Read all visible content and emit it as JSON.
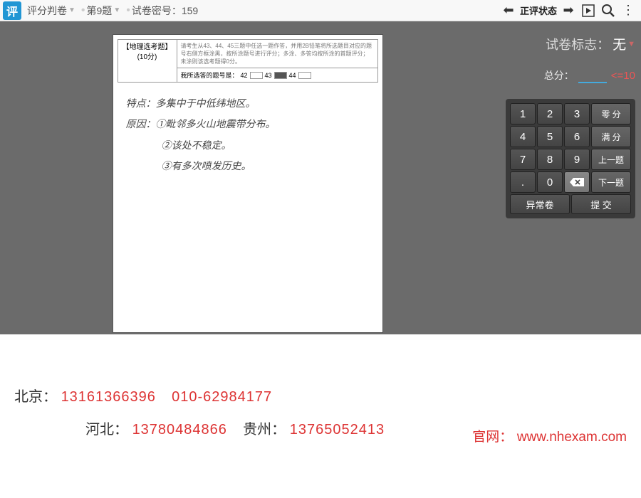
{
  "toolbar": {
    "logo": "评",
    "app_name": "评分判卷",
    "question": "第9题",
    "secret_label": "试卷密号：",
    "secret_value": "159",
    "status": "正评状态"
  },
  "scan": {
    "section_title": "【地理选考题】",
    "section_points": "(10分)",
    "instruction_small": "请考生从43、44、45三题中任选一题作答，并用2B铅笔将所选题目对应的题号右侧方框涂黑，按所涂题号进行评分；多涂、多答均按所涂的首题评分；未涂则该选考题得0分。",
    "choice_label": "我所选答的题号是：",
    "opt1": "42",
    "opt2": "43",
    "opt3": "44",
    "hw_line1": "特点：多集中于中低纬地区。",
    "hw_line2": "原因：①毗邻多火山地震带分布。",
    "hw_line3": "②该处不稳定。",
    "hw_line4": "③有多次喷发历史。"
  },
  "panel": {
    "mark_label": "试卷标志：",
    "mark_value": "无",
    "total_label": "总分：",
    "max_hint": "<=10"
  },
  "keypad": {
    "k1": "1",
    "k2": "2",
    "k3": "3",
    "zero_full": "零 分",
    "k4": "4",
    "k5": "5",
    "k6": "6",
    "full": "满 分",
    "k7": "7",
    "k8": "8",
    "k9": "9",
    "prev": "上一题",
    "dot": ".",
    "k0": "0",
    "bksp": "⌫",
    "next": "下一题",
    "abnormal": "异常卷",
    "submit": "提 交"
  },
  "footer": {
    "bj_label": "北京：",
    "bj_phone1": "13161366396",
    "bj_phone2": "010-62984177",
    "hb_label": "河北：",
    "hb_phone": "13780484866",
    "gz_label": "贵州：",
    "gz_phone": "13765052413",
    "site_label": "官网：",
    "site_url": "www.nhexam.com"
  }
}
